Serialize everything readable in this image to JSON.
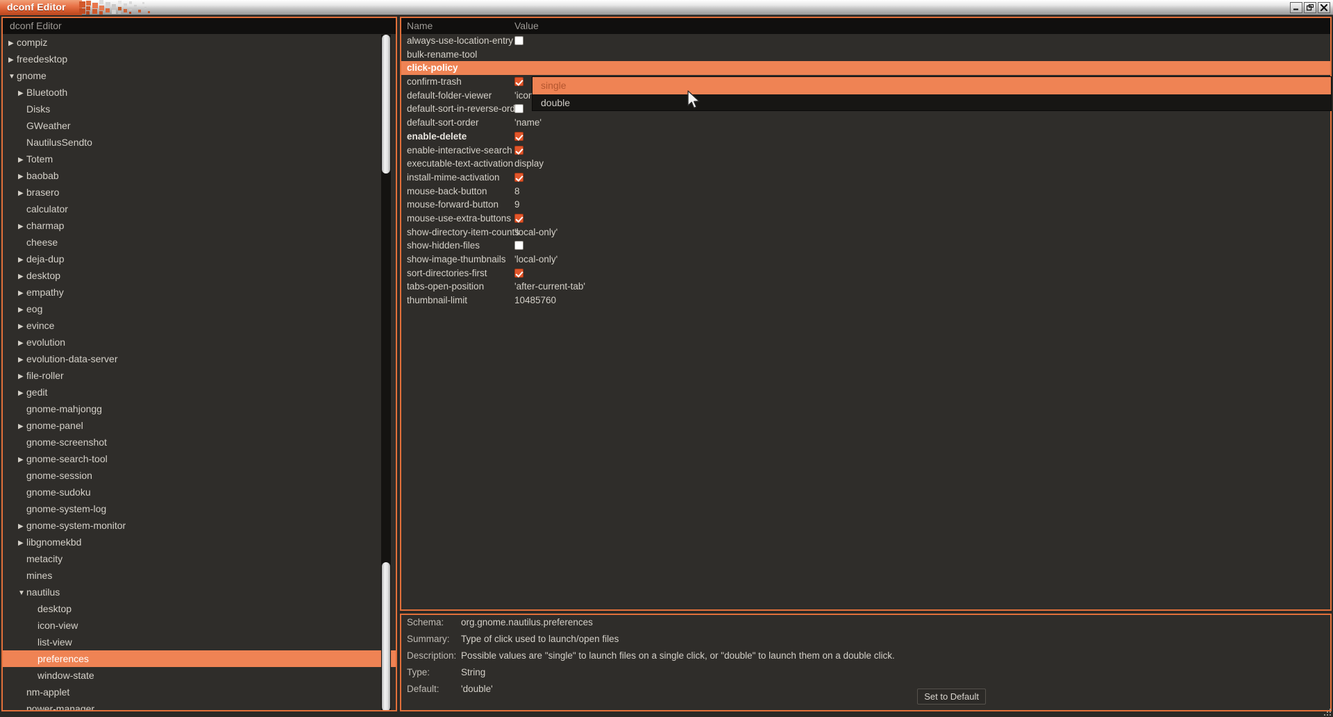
{
  "window": {
    "title": "dconf Editor",
    "buttons": {
      "minimize": "minimize-icon",
      "maximize": "maximize-icon",
      "close": "close-icon"
    }
  },
  "tree": {
    "header": "dconf Editor",
    "items": [
      {
        "label": "compiz",
        "level": 0,
        "twisty": "right",
        "selected": false
      },
      {
        "label": "freedesktop",
        "level": 0,
        "twisty": "right",
        "selected": false
      },
      {
        "label": "gnome",
        "level": 0,
        "twisty": "down",
        "selected": false
      },
      {
        "label": "Bluetooth",
        "level": 1,
        "twisty": "right",
        "selected": false
      },
      {
        "label": "Disks",
        "level": 1,
        "twisty": "none",
        "selected": false
      },
      {
        "label": "GWeather",
        "level": 1,
        "twisty": "none",
        "selected": false
      },
      {
        "label": "NautilusSendto",
        "level": 1,
        "twisty": "none",
        "selected": false
      },
      {
        "label": "Totem",
        "level": 1,
        "twisty": "right",
        "selected": false
      },
      {
        "label": "baobab",
        "level": 1,
        "twisty": "right",
        "selected": false
      },
      {
        "label": "brasero",
        "level": 1,
        "twisty": "right",
        "selected": false
      },
      {
        "label": "calculator",
        "level": 1,
        "twisty": "none",
        "selected": false
      },
      {
        "label": "charmap",
        "level": 1,
        "twisty": "right",
        "selected": false
      },
      {
        "label": "cheese",
        "level": 1,
        "twisty": "none",
        "selected": false
      },
      {
        "label": "deja-dup",
        "level": 1,
        "twisty": "right",
        "selected": false
      },
      {
        "label": "desktop",
        "level": 1,
        "twisty": "right",
        "selected": false
      },
      {
        "label": "empathy",
        "level": 1,
        "twisty": "right",
        "selected": false
      },
      {
        "label": "eog",
        "level": 1,
        "twisty": "right",
        "selected": false
      },
      {
        "label": "evince",
        "level": 1,
        "twisty": "right",
        "selected": false
      },
      {
        "label": "evolution",
        "level": 1,
        "twisty": "right",
        "selected": false
      },
      {
        "label": "evolution-data-server",
        "level": 1,
        "twisty": "right",
        "selected": false
      },
      {
        "label": "file-roller",
        "level": 1,
        "twisty": "right",
        "selected": false
      },
      {
        "label": "gedit",
        "level": 1,
        "twisty": "right",
        "selected": false
      },
      {
        "label": "gnome-mahjongg",
        "level": 1,
        "twisty": "none",
        "selected": false
      },
      {
        "label": "gnome-panel",
        "level": 1,
        "twisty": "right",
        "selected": false
      },
      {
        "label": "gnome-screenshot",
        "level": 1,
        "twisty": "none",
        "selected": false
      },
      {
        "label": "gnome-search-tool",
        "level": 1,
        "twisty": "right",
        "selected": false
      },
      {
        "label": "gnome-session",
        "level": 1,
        "twisty": "none",
        "selected": false
      },
      {
        "label": "gnome-sudoku",
        "level": 1,
        "twisty": "none",
        "selected": false
      },
      {
        "label": "gnome-system-log",
        "level": 1,
        "twisty": "none",
        "selected": false
      },
      {
        "label": "gnome-system-monitor",
        "level": 1,
        "twisty": "right",
        "selected": false
      },
      {
        "label": "libgnomekbd",
        "level": 1,
        "twisty": "right",
        "selected": false
      },
      {
        "label": "metacity",
        "level": 1,
        "twisty": "none",
        "selected": false
      },
      {
        "label": "mines",
        "level": 1,
        "twisty": "none",
        "selected": false
      },
      {
        "label": "nautilus",
        "level": 1,
        "twisty": "down",
        "selected": false
      },
      {
        "label": "desktop",
        "level": 2,
        "twisty": "none",
        "selected": false
      },
      {
        "label": "icon-view",
        "level": 2,
        "twisty": "none",
        "selected": false
      },
      {
        "label": "list-view",
        "level": 2,
        "twisty": "none",
        "selected": false
      },
      {
        "label": "preferences",
        "level": 2,
        "twisty": "none",
        "selected": true
      },
      {
        "label": "window-state",
        "level": 2,
        "twisty": "none",
        "selected": false
      },
      {
        "label": "nm-applet",
        "level": 1,
        "twisty": "none",
        "selected": false
      },
      {
        "label": "power-manager",
        "level": 1,
        "twisty": "none",
        "selected": false
      }
    ]
  },
  "keylist": {
    "columns": {
      "name": "Name",
      "value": "Value"
    },
    "rows": [
      {
        "name": "always-use-location-entry",
        "value": "",
        "kind": "checkbox",
        "checked": false,
        "modified": false,
        "selected": false
      },
      {
        "name": "bulk-rename-tool",
        "value": "",
        "kind": "text",
        "modified": false,
        "selected": false
      },
      {
        "name": "click-policy",
        "value": "",
        "kind": "text",
        "modified": true,
        "selected": true
      },
      {
        "name": "confirm-trash",
        "value": "",
        "kind": "checkbox",
        "checked": true,
        "modified": false,
        "selected": false
      },
      {
        "name": "default-folder-viewer",
        "value": "'icon-view'",
        "kind": "text",
        "modified": false,
        "selected": false
      },
      {
        "name": "default-sort-in-reverse-order",
        "value": "",
        "kind": "checkbox",
        "checked": false,
        "modified": false,
        "selected": false
      },
      {
        "name": "default-sort-order",
        "value": "'name'",
        "kind": "text",
        "modified": false,
        "selected": false
      },
      {
        "name": "enable-delete",
        "value": "",
        "kind": "checkbox",
        "checked": true,
        "modified": true,
        "selected": false
      },
      {
        "name": "enable-interactive-search",
        "value": "",
        "kind": "checkbox",
        "checked": true,
        "modified": false,
        "selected": false
      },
      {
        "name": "executable-text-activation",
        "value": "display",
        "kind": "text",
        "modified": false,
        "selected": false
      },
      {
        "name": "install-mime-activation",
        "value": "",
        "kind": "checkbox",
        "checked": true,
        "modified": false,
        "selected": false
      },
      {
        "name": "mouse-back-button",
        "value": "8",
        "kind": "text",
        "modified": false,
        "selected": false
      },
      {
        "name": "mouse-forward-button",
        "value": "9",
        "kind": "text",
        "modified": false,
        "selected": false
      },
      {
        "name": "mouse-use-extra-buttons",
        "value": "",
        "kind": "checkbox",
        "checked": true,
        "modified": false,
        "selected": false
      },
      {
        "name": "show-directory-item-counts",
        "value": "'local-only'",
        "kind": "text",
        "modified": false,
        "selected": false
      },
      {
        "name": "show-hidden-files",
        "value": "",
        "kind": "checkbox",
        "checked": false,
        "modified": false,
        "selected": false
      },
      {
        "name": "show-image-thumbnails",
        "value": "'local-only'",
        "kind": "text",
        "modified": false,
        "selected": false
      },
      {
        "name": "sort-directories-first",
        "value": "",
        "kind": "checkbox",
        "checked": true,
        "modified": false,
        "selected": false
      },
      {
        "name": "tabs-open-position",
        "value": "'after-current-tab'",
        "kind": "text",
        "modified": false,
        "selected": false
      },
      {
        "name": "thumbnail-limit",
        "value": "10485760",
        "kind": "text",
        "modified": false,
        "selected": false
      }
    ]
  },
  "dropdown": {
    "open": true,
    "options": [
      {
        "label": "single",
        "highlighted": true
      },
      {
        "label": "double",
        "highlighted": false
      }
    ]
  },
  "detail": {
    "schema_label": "Schema:",
    "schema_value": "org.gnome.nautilus.preferences",
    "summary_label": "Summary:",
    "summary_value": "Type of click used to launch/open files",
    "description_label": "Description:",
    "description_value": "Possible values are \"single\" to launch files on a single click, or \"double\" to launch them on a double click.",
    "type_label": "Type:",
    "type_value": "String",
    "default_label": "Default:",
    "default_value": "'double'",
    "set_to_default": "Set to Default"
  },
  "colors": {
    "accent": "#ef8354",
    "accent_border": "#e2703a",
    "checkbox_on": "#e2562a",
    "panel_bg": "#2f2d2a",
    "header_bg": "#100f0e"
  }
}
